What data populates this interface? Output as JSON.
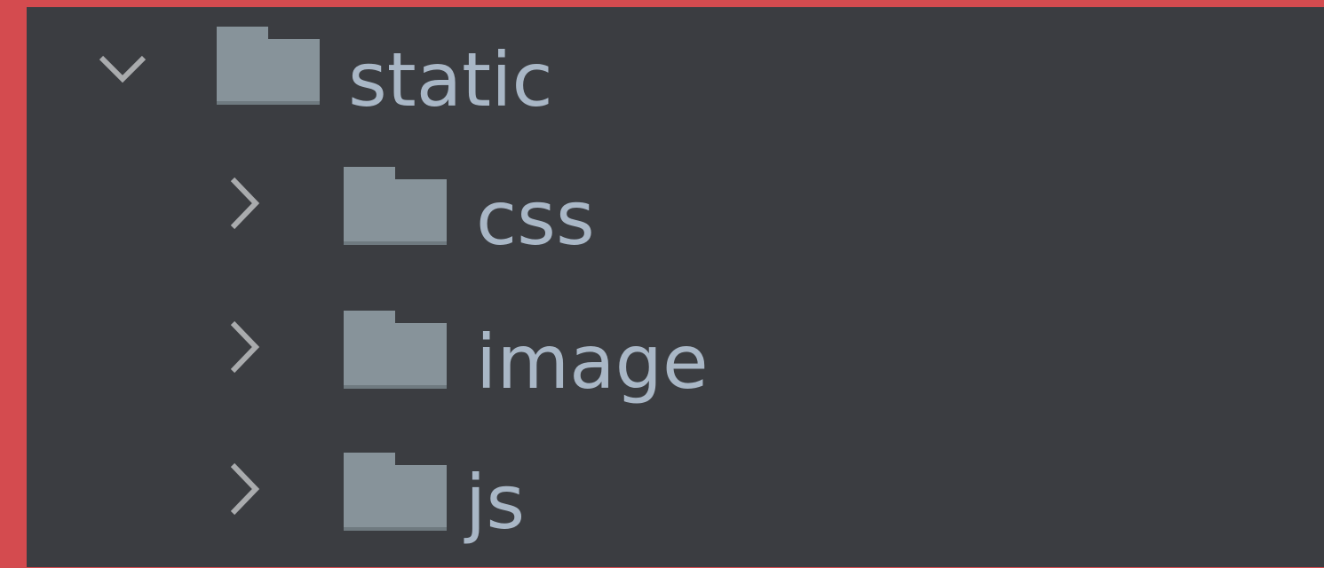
{
  "file_tree": {
    "items": [
      {
        "label": "static",
        "expanded": true,
        "icon": "folder-icon",
        "toggle_icon": "chevron-down-icon"
      },
      {
        "label": "css",
        "expanded": false,
        "icon": "folder-icon",
        "toggle_icon": "chevron-right-icon"
      },
      {
        "label": "image",
        "expanded": false,
        "icon": "folder-icon",
        "toggle_icon": "chevron-right-icon"
      },
      {
        "label": "js",
        "expanded": false,
        "icon": "folder-icon",
        "toggle_icon": "chevron-right-icon"
      }
    ]
  },
  "colors": {
    "frame": "#d44b4f",
    "panel_background": "#3b3d41",
    "folder": "#87939a",
    "chevron": "#a9abad",
    "label_text": "#a9b7c6"
  }
}
